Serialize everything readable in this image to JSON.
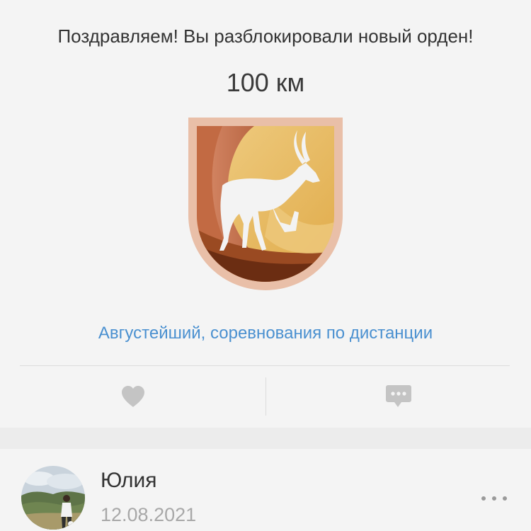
{
  "achievement": {
    "title": "Поздравляем! Вы разблокировали новый орден!",
    "distance": "100 км",
    "medal_name": "Августейший, соревнования по дистанции",
    "badge_icon": "antelope-icon"
  },
  "actions": {
    "like_icon": "heart-icon",
    "comment_icon": "comment-icon"
  },
  "post": {
    "user_name": "Юлия",
    "date": "12.08.2021",
    "more_icon": "more-dots-icon"
  },
  "colors": {
    "link": "#4a90d0",
    "icon_gray": "#c4c4c4",
    "badge_border": "#e9bfa8",
    "badge_gold": "#e2b45a"
  }
}
